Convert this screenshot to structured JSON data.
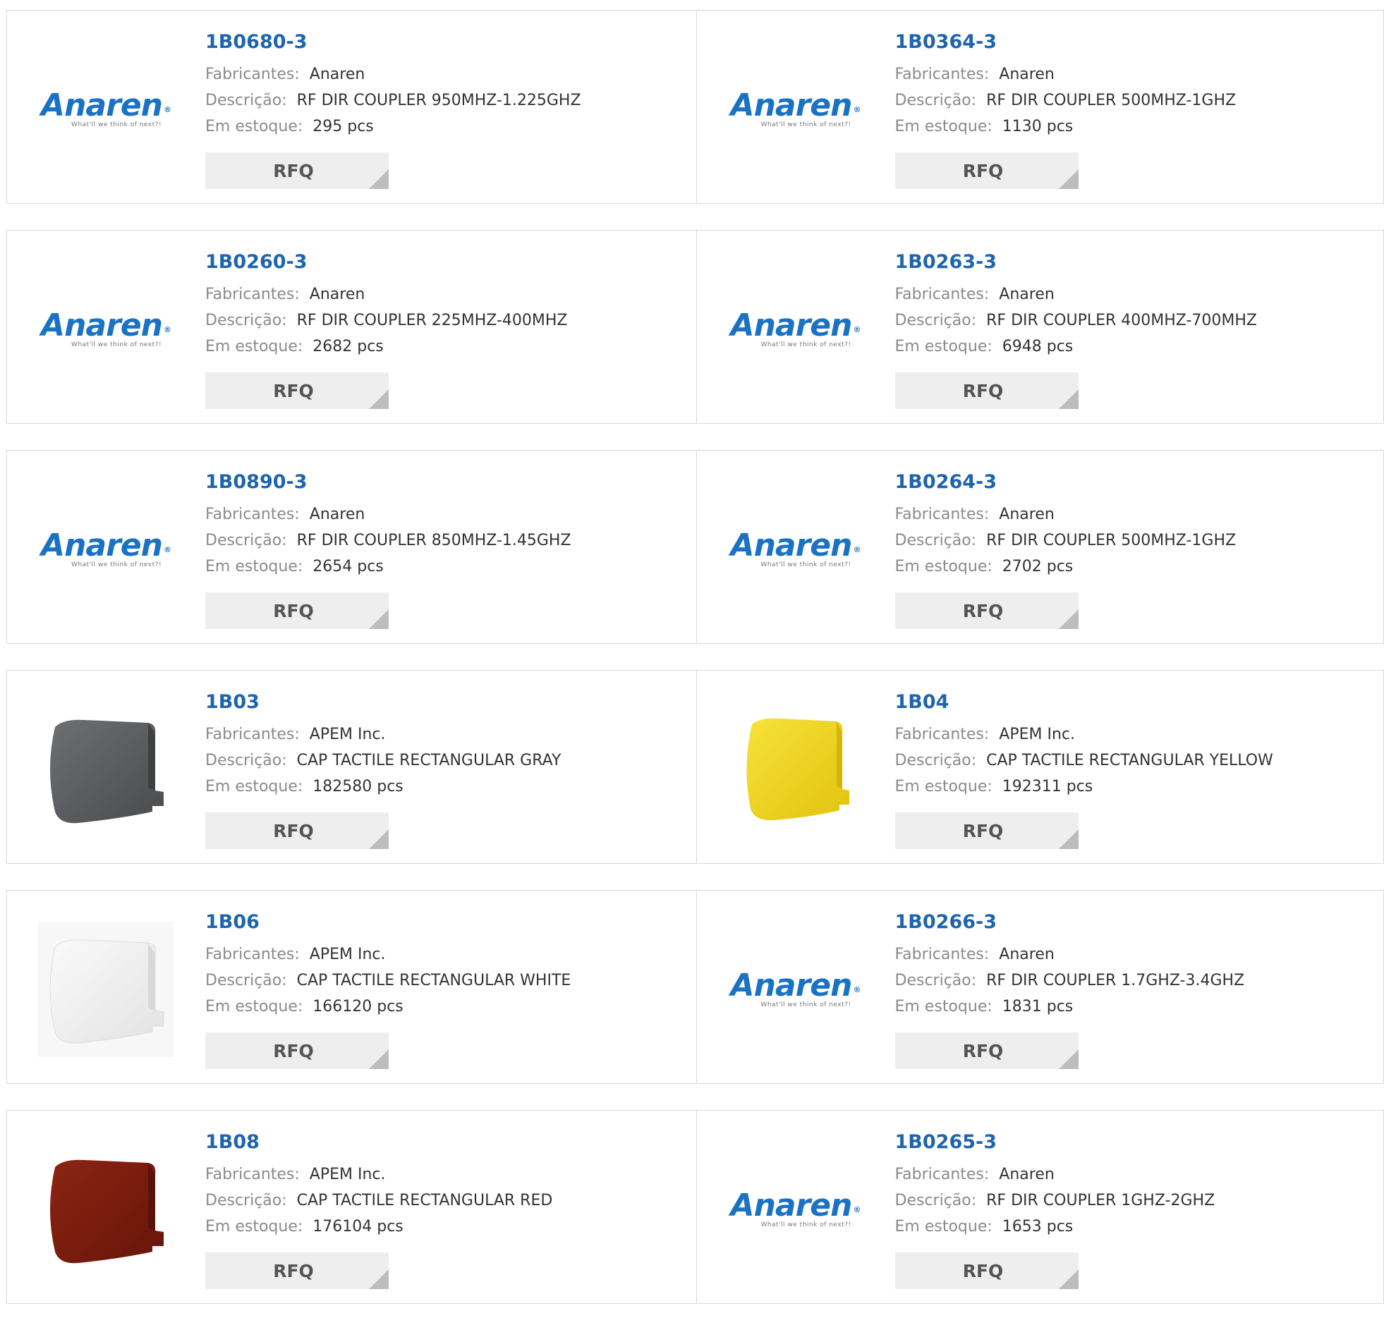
{
  "labels": {
    "manufacturer": "Fabricantes:",
    "description": "Descrição:",
    "stock": "Em estoque:",
    "rfq": "RFQ"
  },
  "logo": {
    "word": "Anaren",
    "reg": "®",
    "tagline": "What'll we think of next?!"
  },
  "colors": {
    "link": "#1e64ae",
    "gray_cap": "#5a5b5d",
    "yellow_cap": "#f2d21a",
    "white_cap": "#ececec",
    "red_cap": "#7a1a0c"
  },
  "products": [
    {
      "part": "1B0680-3",
      "manufacturer": "Anaren",
      "description": "RF DIR COUPLER 950MHZ-1.225GHZ",
      "stock": "295 pcs",
      "image": "anaren-logo"
    },
    {
      "part": "1B0364-3",
      "manufacturer": "Anaren",
      "description": "RF DIR COUPLER 500MHZ-1GHZ",
      "stock": "1130 pcs",
      "image": "anaren-logo"
    },
    {
      "part": "1B0260-3",
      "manufacturer": "Anaren",
      "description": "RF DIR COUPLER 225MHZ-400MHZ",
      "stock": "2682 pcs",
      "image": "anaren-logo"
    },
    {
      "part": "1B0263-3",
      "manufacturer": "Anaren",
      "description": "RF DIR COUPLER 400MHZ-700MHZ",
      "stock": "6948 pcs",
      "image": "anaren-logo"
    },
    {
      "part": "1B0890-3",
      "manufacturer": "Anaren",
      "description": "RF DIR COUPLER 850MHZ-1.45GHZ",
      "stock": "2654 pcs",
      "image": "anaren-logo"
    },
    {
      "part": "1B0264-3",
      "manufacturer": "Anaren",
      "description": "RF DIR COUPLER 500MHZ-1GHZ",
      "stock": "2702 pcs",
      "image": "anaren-logo"
    },
    {
      "part": "1B03",
      "manufacturer": "APEM Inc.",
      "description": "CAP TACTILE RECTANGULAR GRAY",
      "stock": "182580 pcs",
      "image": "gray-cap"
    },
    {
      "part": "1B04",
      "manufacturer": "APEM Inc.",
      "description": "CAP TACTILE RECTANGULAR YELLOW",
      "stock": "192311 pcs",
      "image": "yellow-cap"
    },
    {
      "part": "1B06",
      "manufacturer": "APEM Inc.",
      "description": "CAP TACTILE RECTANGULAR WHITE",
      "stock": "166120 pcs",
      "image": "white-cap"
    },
    {
      "part": "1B0266-3",
      "manufacturer": "Anaren",
      "description": "RF DIR COUPLER 1.7GHZ-3.4GHZ",
      "stock": "1831 pcs",
      "image": "anaren-logo"
    },
    {
      "part": "1B08",
      "manufacturer": "APEM Inc.",
      "description": "CAP TACTILE RECTANGULAR RED",
      "stock": "176104 pcs",
      "image": "red-cap"
    },
    {
      "part": "1B0265-3",
      "manufacturer": "Anaren",
      "description": "RF DIR COUPLER 1GHZ-2GHZ",
      "stock": "1653 pcs",
      "image": "anaren-logo"
    }
  ]
}
